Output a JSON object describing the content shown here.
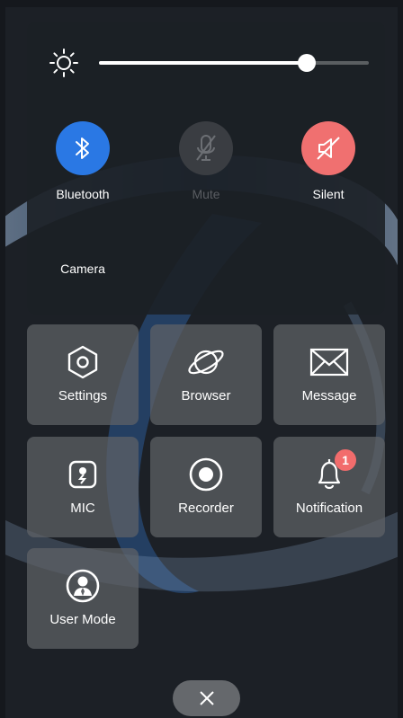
{
  "brightness": {
    "level": 0.77
  },
  "toggles": {
    "bluetooth": {
      "label": "Bluetooth",
      "state": "on",
      "color": "#2a78e4"
    },
    "mute": {
      "label": "Mute",
      "state": "disabled"
    },
    "silent": {
      "label": "Silent",
      "state": "on",
      "color": "#f07070"
    },
    "camera": {
      "label": "Camera"
    }
  },
  "tiles": {
    "settings": {
      "label": "Settings",
      "icon": "hexagon-gear-icon"
    },
    "browser": {
      "label": "Browser",
      "icon": "planet-icon"
    },
    "message": {
      "label": "Message",
      "icon": "envelope-icon"
    },
    "mic": {
      "label": "MIC",
      "icon": "mic-chip-icon"
    },
    "recorder": {
      "label": "Recorder",
      "icon": "record-icon"
    },
    "notification": {
      "label": "Notification",
      "icon": "bell-icon",
      "badge": "1"
    },
    "user_mode": {
      "label": "User Mode",
      "icon": "user-icon"
    }
  },
  "close": {
    "icon": "close-icon"
  }
}
